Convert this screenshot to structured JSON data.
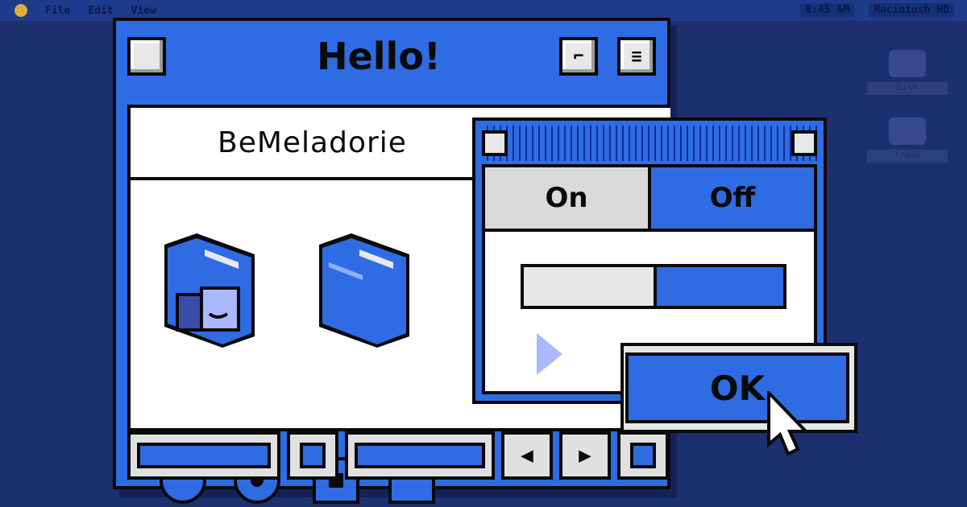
{
  "desktop": {
    "menubar": {
      "items": [
        "File",
        "Edit",
        "View"
      ],
      "right_items": [
        "8:45 AM",
        "Macintosh HD"
      ]
    },
    "desktop_icons": [
      "Disk",
      "Trash"
    ]
  },
  "main_window": {
    "title": "Hello!",
    "subtitle": "BeMeladorie",
    "buttons": {
      "close": "close",
      "zoom": "zoom",
      "collapse": "collapse"
    },
    "folders": [
      {
        "name": "Finder folder"
      },
      {
        "name": "Folder"
      }
    ],
    "controls": [
      "radio",
      "radio-selected",
      "checkbox-selected",
      "checkbox"
    ]
  },
  "dialog": {
    "segments": {
      "on": "On",
      "off": "Off"
    },
    "progress_fraction": 0.5
  },
  "ok_button": {
    "label": "OK"
  },
  "colors": {
    "desktop": "#1c2f6e",
    "accent": "#2f6be3",
    "panel": "#ffffff"
  }
}
